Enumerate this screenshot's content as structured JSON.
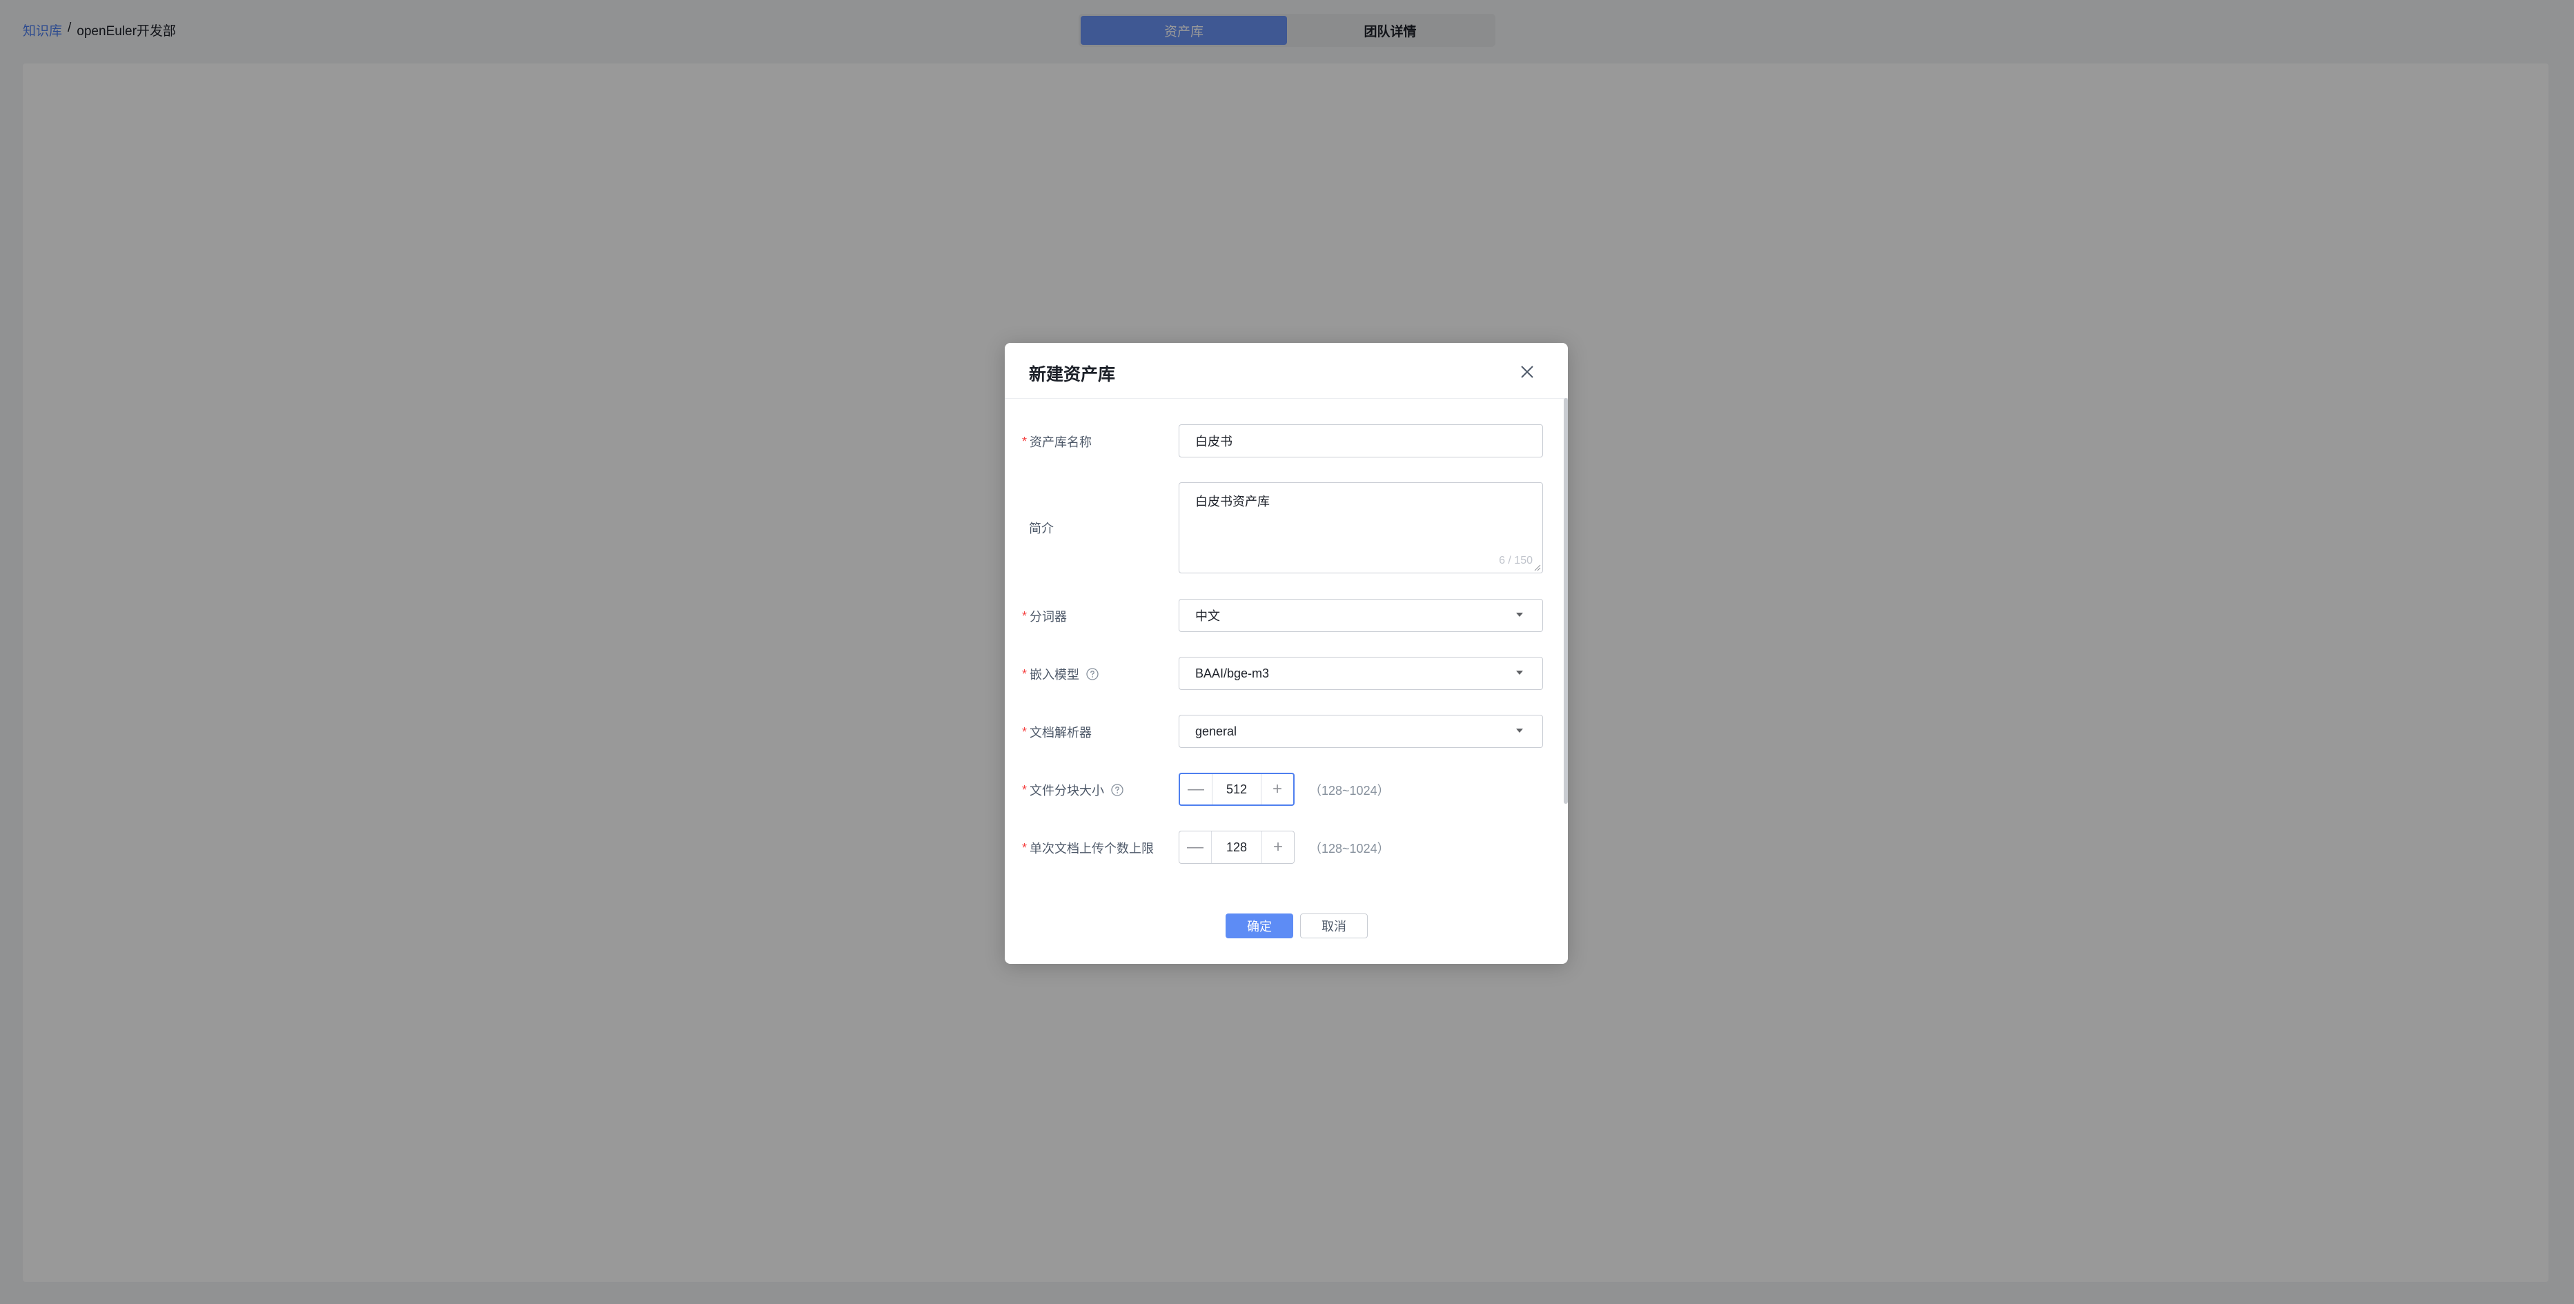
{
  "breadcrumb": {
    "root": "知识库",
    "separator": "/",
    "current": "openEuler开发部"
  },
  "tabs": [
    {
      "label": "资产库",
      "active": true
    },
    {
      "label": "团队详情",
      "active": false
    }
  ],
  "modal": {
    "title": "新建资产库",
    "fields": {
      "name": {
        "label": "资产库名称",
        "required": true,
        "value": "白皮书"
      },
      "intro": {
        "label": "简介",
        "required": false,
        "value": "白皮书资产库",
        "counter": "6 / 150"
      },
      "tokenizer": {
        "label": "分词器",
        "required": true,
        "value": "中文"
      },
      "embedding": {
        "label": "嵌入模型",
        "required": true,
        "value": "BAAI/bge-m3"
      },
      "parser": {
        "label": "文档解析器",
        "required": true,
        "value": "general"
      },
      "chunk_size": {
        "label": "文件分块大小",
        "required": true,
        "value": "512",
        "range": "（128~1024）"
      },
      "upload_limit": {
        "label": "单次文档上传个数上限",
        "required": true,
        "value": "128",
        "range": "（128~1024）"
      }
    },
    "buttons": {
      "confirm": "确定",
      "cancel": "取消"
    },
    "required_mark": "*",
    "stepper_minus": "—",
    "stepper_plus": "+"
  },
  "colors": {
    "accent": "#5d8cf5",
    "required": "#f53f3f",
    "link": "#4e7fef"
  }
}
